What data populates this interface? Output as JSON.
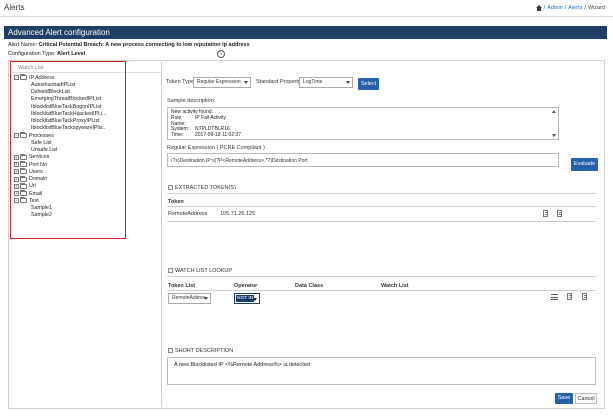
{
  "app": {
    "title": "Alerts"
  },
  "breadcrumb": {
    "sep": "/",
    "admin": "Admin",
    "alerts": "Alerts",
    "wizard": "Wizard"
  },
  "header": {
    "title": "Advanced Alert configuration"
  },
  "alert": {
    "name_label": "Alert Name:",
    "name_value": "Critical Potential Breach: A new process connecting to low reputation ip address",
    "type_label": "Configuration Type:",
    "type_value": "Alert Level"
  },
  "watchlist": {
    "header": "Watch List"
  },
  "tree": [
    {
      "label": "IP Address",
      "level": 0,
      "expander": "-",
      "folder": true
    },
    {
      "label": "AutoshunbadIPList",
      "level": 1,
      "expander": "",
      "folder": false
    },
    {
      "label": "DshieldBlockList",
      "level": 1,
      "expander": "",
      "folder": false
    },
    {
      "label": "EmergingThreatBlockedIPList",
      "level": 1,
      "expander": "",
      "folder": false
    },
    {
      "label": "IblocklistBlueTackBogonIPList",
      "level": 1,
      "expander": "",
      "folder": false
    },
    {
      "label": "IblocklistBlueTackHijackedIPLi...",
      "level": 1,
      "expander": "",
      "folder": false
    },
    {
      "label": "IblocklistBlueTackProxyIPList",
      "level": 1,
      "expander": "",
      "folder": false
    },
    {
      "label": "IblocklistBlueTackspywareIPlis..",
      "level": 1,
      "expander": "",
      "folder": false
    },
    {
      "label": "Processes",
      "level": 0,
      "expander": "-",
      "folder": true
    },
    {
      "label": "Safe List",
      "level": 1,
      "expander": "",
      "folder": false
    },
    {
      "label": "Unsafe List",
      "level": 1,
      "expander": "",
      "folder": false
    },
    {
      "label": "Services",
      "level": 0,
      "expander": "+",
      "folder": true
    },
    {
      "label": "Port No",
      "level": 0,
      "expander": "+",
      "folder": true
    },
    {
      "label": "Users",
      "level": 0,
      "expander": "+",
      "folder": true
    },
    {
      "label": "Domain",
      "level": 0,
      "expander": "+",
      "folder": true
    },
    {
      "label": "Url",
      "level": 0,
      "expander": "+",
      "folder": true
    },
    {
      "label": "Email",
      "level": 0,
      "expander": "+",
      "folder": true
    },
    {
      "label": "Test",
      "level": 0,
      "expander": "-",
      "folder": true
    },
    {
      "label": "Sample1",
      "level": 1,
      "expander": "",
      "folder": false
    },
    {
      "label": "Sample2",
      "level": 1,
      "expander": "",
      "folder": false
    }
  ],
  "token": {
    "type_label": "Token Type",
    "type_value": "Regular Expression",
    "prop_label": "Standard Property",
    "prop_value": "LogTime",
    "select_label": "Select"
  },
  "sample": {
    "label": "Sample description:",
    "line1": "New activity found:",
    "rows": [
      {
        "k": "Rule Name:",
        "v": "IP Fail Activity"
      },
      {
        "k": "System:",
        "v": "NTPLDTBLR16"
      },
      {
        "k": "Time:",
        "v": "2017-09-18 11:02:37"
      }
    ]
  },
  "regex": {
    "label": "Regular Expression ( PCRE Compliant )",
    "value": "(?s)Destination IP:s(?P<RemoteAddress>.*?)Destination Port",
    "evaluate_label": "Evaluate"
  },
  "extracted": {
    "label": "EXTRACTED TOKEN(S)",
    "col": "Token",
    "name": "RemoteAddress",
    "value": "105.71.26.125"
  },
  "watch_lookup": {
    "label": "WATCH LIST LOOKUP",
    "cols": {
      "token_list": "Token List",
      "operator": "Operator",
      "data_class": "Data Class",
      "watch_list": "Watch List"
    },
    "token_value": "RemoteAddres",
    "operator_value": "NOT IN"
  },
  "short": {
    "label": "SHORT DESCRIPTION",
    "value": "A new Blacklisted IP <%Remote Address%> is detected"
  },
  "footer": {
    "save": "Save",
    "cancel": "Cancel"
  },
  "colors": {
    "accent": "#2560a8",
    "header_bg": "#1f3f66",
    "highlight_box": "#d9232a"
  }
}
